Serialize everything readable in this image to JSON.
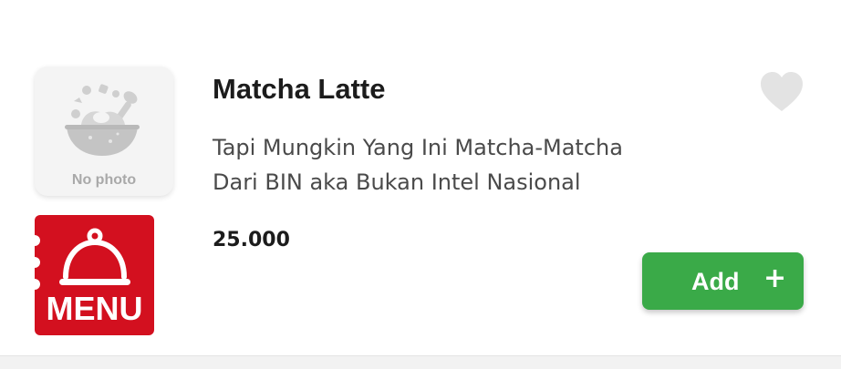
{
  "item": {
    "name": "Matcha Latte",
    "description_line1": "Tapi Mungkin Yang Ini Matcha-Matcha",
    "description_line2": "Dari BIN aka Bukan Intel Nasional",
    "price": "25.000",
    "thumbnail": {
      "placeholder_label": "No photo",
      "icon": "food-bowl-icon"
    },
    "favorite_icon": "heart-icon"
  },
  "menu_badge": {
    "label": "MENU",
    "icon": "cloche-icon",
    "color": "#d3101f"
  },
  "add_button": {
    "label": "Add",
    "icon": "plus-icon",
    "symbol": "+",
    "color": "#3aaa48"
  }
}
